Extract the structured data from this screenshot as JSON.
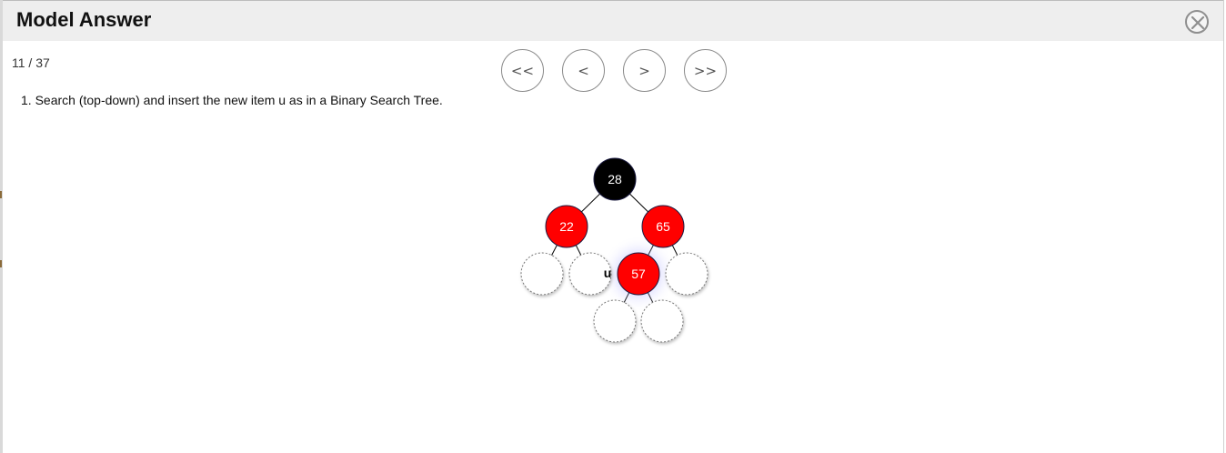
{
  "dialog": {
    "title": "Model Answer",
    "close_icon": "close-circle-x-icon"
  },
  "nav": {
    "counter": "11 / 37",
    "first_label": "<<",
    "prev_label": "<",
    "next_label": ">",
    "last_label": ">>"
  },
  "instruction": "1. Search (top-down) and insert the new item u as in a Binary Search Tree.",
  "tree": {
    "insert_label": "u",
    "nodes": [
      {
        "id": "n28",
        "value": "28",
        "color": "#000000"
      },
      {
        "id": "n22",
        "value": "22",
        "color": "#ff0000"
      },
      {
        "id": "n65",
        "value": "65",
        "color": "#ff0000"
      },
      {
        "id": "n57",
        "value": "57",
        "color": "#ff0000",
        "highlighted": true
      },
      {
        "id": "nil1",
        "value": "",
        "color": "null"
      },
      {
        "id": "nil2",
        "value": "",
        "color": "null"
      },
      {
        "id": "nil3",
        "value": "",
        "color": "null"
      },
      {
        "id": "nil4",
        "value": "",
        "color": "null"
      },
      {
        "id": "nil5",
        "value": "",
        "color": "null"
      }
    ]
  }
}
